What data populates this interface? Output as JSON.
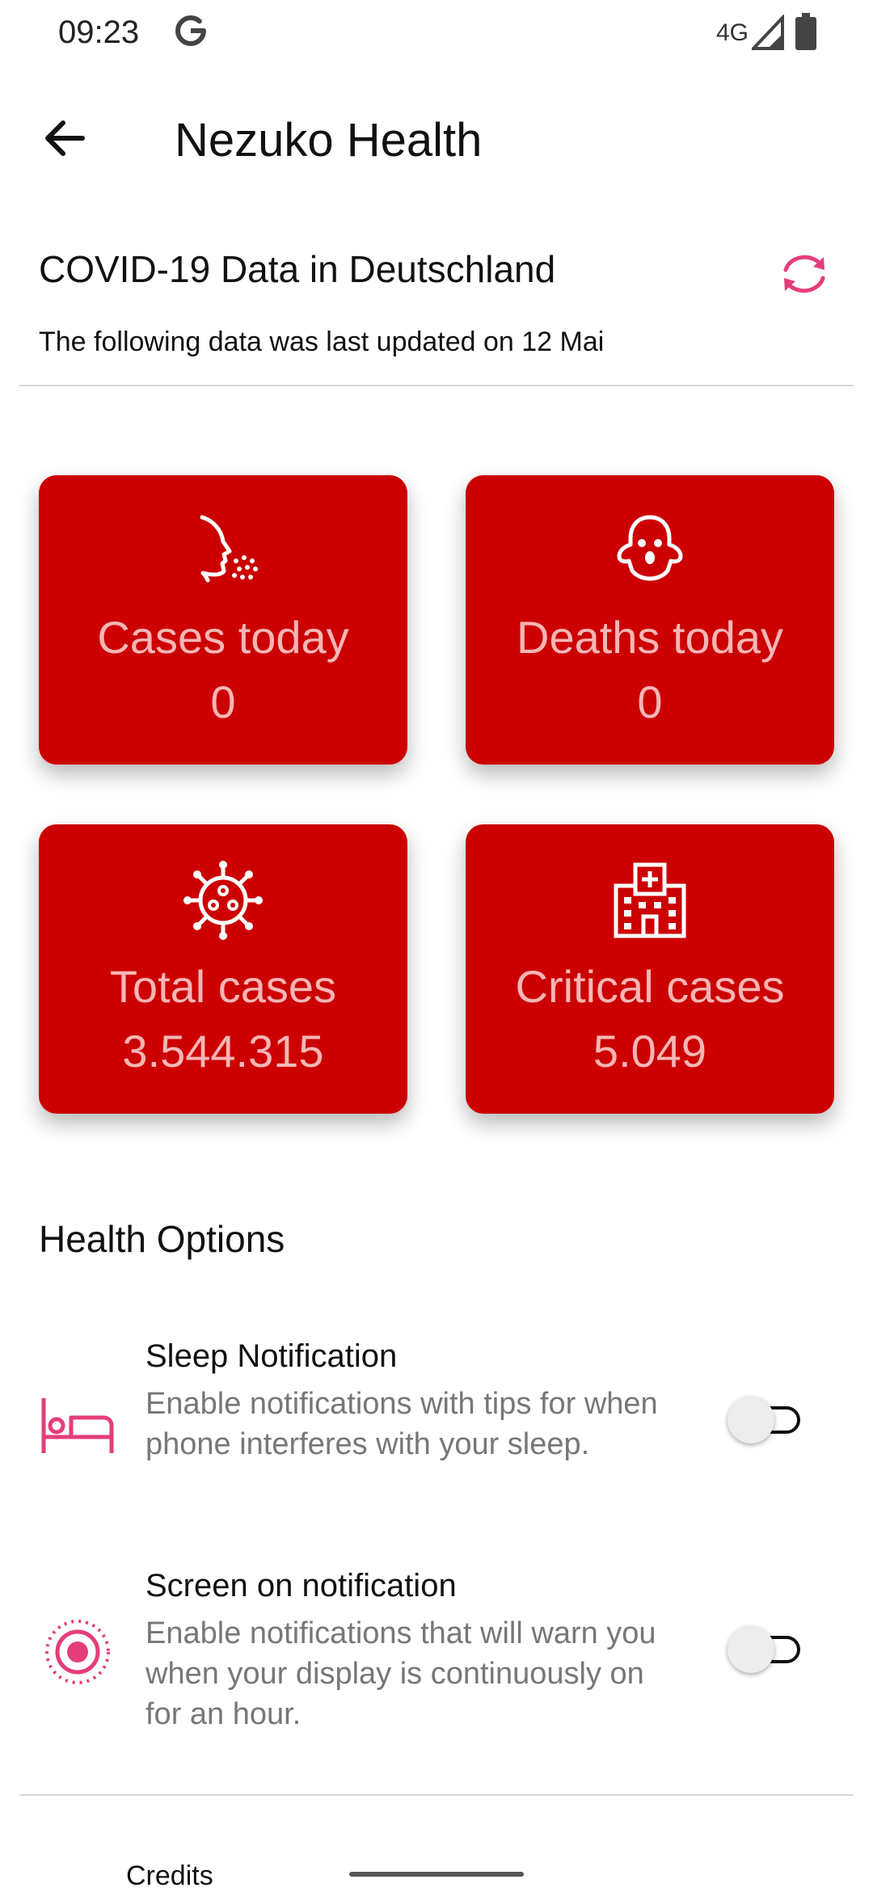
{
  "status_bar": {
    "time": "09:23",
    "network": "4G"
  },
  "app_bar": {
    "title": "Nezuko Health"
  },
  "covid": {
    "header": "COVID-19 Data in Deutschland",
    "updated": "The following data was last updated on 12 Mai",
    "cards": [
      {
        "label": "Cases today",
        "value": "0",
        "icon": "sneeze-icon"
      },
      {
        "label": "Deaths today",
        "value": "0",
        "icon": "ghost-icon"
      },
      {
        "label": "Total cases",
        "value": "3.544.315",
        "icon": "virus-icon"
      },
      {
        "label": "Critical cases",
        "value": "5.049",
        "icon": "hospital-icon"
      }
    ]
  },
  "health_options": {
    "title": "Health Options",
    "items": [
      {
        "title": "Sleep Notification",
        "description": "Enable notifications with tips for when phone interferes with your sleep.",
        "icon": "bed-icon",
        "enabled": false
      },
      {
        "title": "Screen on notification",
        "description": "Enable notifications that will warn you when your display is continuously on for an hour.",
        "icon": "target-icon",
        "enabled": false
      }
    ]
  },
  "footer": {
    "credits": "Credits"
  },
  "colors": {
    "card": "#cc0000",
    "card_text": "#f6b6b6",
    "accent": "#e53d7a"
  }
}
